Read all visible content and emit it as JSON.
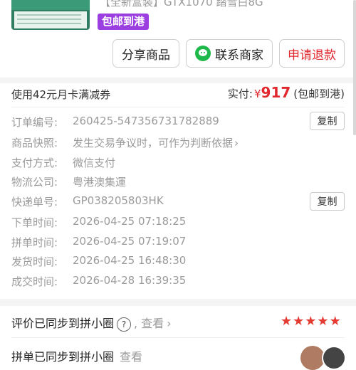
{
  "product": {
    "title": "【全新盒装】GTX1070 踏雪白8G",
    "tag": "包邮到港"
  },
  "actions": {
    "share": "分享商品",
    "contact": "联系商家",
    "refund": "申请退款"
  },
  "payment": {
    "coupon": "使用42元月卡满减券",
    "paid_label": "实付:",
    "currency": "¥",
    "amount": "917",
    "note": "(包邮到港)"
  },
  "details": [
    {
      "label": "订单编号:",
      "value": "260425-547356731782889",
      "copy": "复制"
    },
    {
      "label": "商品快照:",
      "value": "发生交易争议时，可作为判断依据"
    },
    {
      "label": "支付方式:",
      "value": "微信支付"
    },
    {
      "label": "物流公司:",
      "value": "粤港澳集運"
    },
    {
      "label": "快递单号:",
      "value": "GP038205803HK",
      "copy": "复制"
    },
    {
      "label": "下单时间:",
      "value": "2026-04-25 07:18:25"
    },
    {
      "label": "拼单时间:",
      "value": "2026-04-25 07:19:07"
    },
    {
      "label": "发货时间:",
      "value": "2026-04-25 16:48:30"
    },
    {
      "label": "成交时间:",
      "value": "2026-04-28 16:39:35"
    }
  ],
  "review": {
    "text": "评价已同步到拼小圈",
    "help": "?",
    "view": "查看",
    "stars": 5
  },
  "review2": {
    "text": "拼单已同步到拼小圈",
    "view": "查看"
  },
  "colors": {
    "accent": "#e0282e",
    "tag": "#9b3fe0",
    "wechat": "#1fb84a"
  }
}
